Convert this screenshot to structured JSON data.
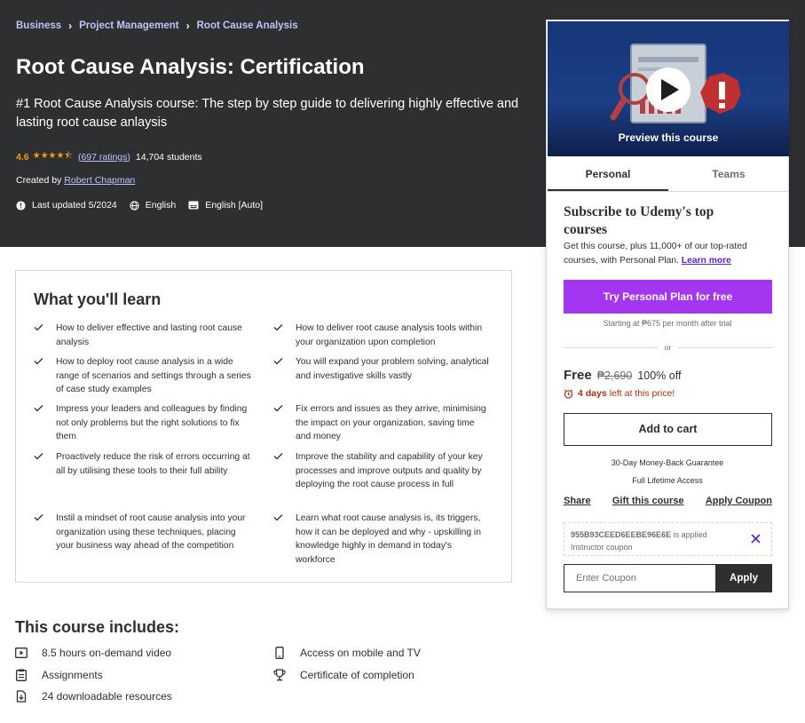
{
  "breadcrumb": [
    "Business",
    "Project Management",
    "Root Cause Analysis"
  ],
  "course": {
    "title": "Root Cause Analysis: Certification",
    "subtitle": "#1 Root Cause Analysis course: The step by step guide to delivering highly effective and lasting root cause anlaysis",
    "rating": "4.6",
    "rating_stars": 4.5,
    "ratings_count": "(697 ratings)",
    "students": "14,704 students",
    "created_by_label": "Created by",
    "author": "Robert Chapman",
    "last_updated": "Last updated 5/2024",
    "language": "English",
    "captions": "English [Auto]"
  },
  "learn": {
    "title": "What you'll learn",
    "items": [
      "How to deliver effective and lasting root cause analysis",
      "How to deliver root cause analysis tools within your organization upon completion",
      "How to deploy root cause analysis in a wide range of scenarios and settings through a series of case study examples",
      "You will expand your problem solving, analytical and investigative skills vastly",
      "Impress your leaders and colleagues by finding not only problems but the right solutions to fix them",
      "Fix errors and issues as they arrive, minimising the impact on your organization, saving time and money",
      "Proactively reduce the risk of errors occurring at all by utilising these tools to their full ability",
      "Improve the stability and capability of your key processes and improve outputs and quality by deploying the root cause process in full",
      "Instil a mindset of root cause analysis into your organization using these techniques, placing your business way ahead of the competition",
      "Learn what root cause analysis is, its triggers, how it can be deployed and why - upskilling in knowledge highly in demand in today's workforce"
    ]
  },
  "includes": {
    "title": "This course includes:",
    "items": [
      {
        "icon": "video-icon",
        "label": "8.5 hours on-demand video"
      },
      {
        "icon": "mobile-icon",
        "label": "Access on mobile and TV"
      },
      {
        "icon": "assignment-icon",
        "label": "Assignments"
      },
      {
        "icon": "trophy-icon",
        "label": "Certificate of completion"
      },
      {
        "icon": "download-icon",
        "label": "24 downloadable resources"
      }
    ]
  },
  "sidebar": {
    "preview_label": "Preview this course",
    "tabs": [
      "Personal",
      "Teams"
    ],
    "subscribe_title": "Subscribe to Udemy's top courses",
    "subscribe_desc": "Get this course, plus 11,000+ of our top-rated courses, with Personal Plan.",
    "learn_more": "Learn more",
    "try_plan_button": "Try Personal Plan for free",
    "starting_at": "Starting at ₱675 per month after trial",
    "or": "or",
    "price_free": "Free",
    "price_original": "₱2,690",
    "discount": "100% off",
    "days_left": "4 days",
    "days_left_suffix": "left at this price!",
    "add_to_cart": "Add to cart",
    "guarantee": "30-Day Money-Back Guarantee",
    "lifetime": "Full Lifetime Access",
    "share": "Share",
    "gift": "Gift this course",
    "apply_coupon": "Apply Coupon",
    "coupon_code": "955B93CEED6EEBE96E6E",
    "coupon_applied": "is applied",
    "coupon_type": "Instructor coupon",
    "coupon_placeholder": "Enter Coupon",
    "apply_button": "Apply"
  },
  "colors": {
    "hero_bg": "#2d2f31",
    "accent_purple": "#a435f0",
    "link_purple": "#5624d0",
    "star_orange": "#f69c08",
    "countdown_red": "#b32d0f"
  }
}
